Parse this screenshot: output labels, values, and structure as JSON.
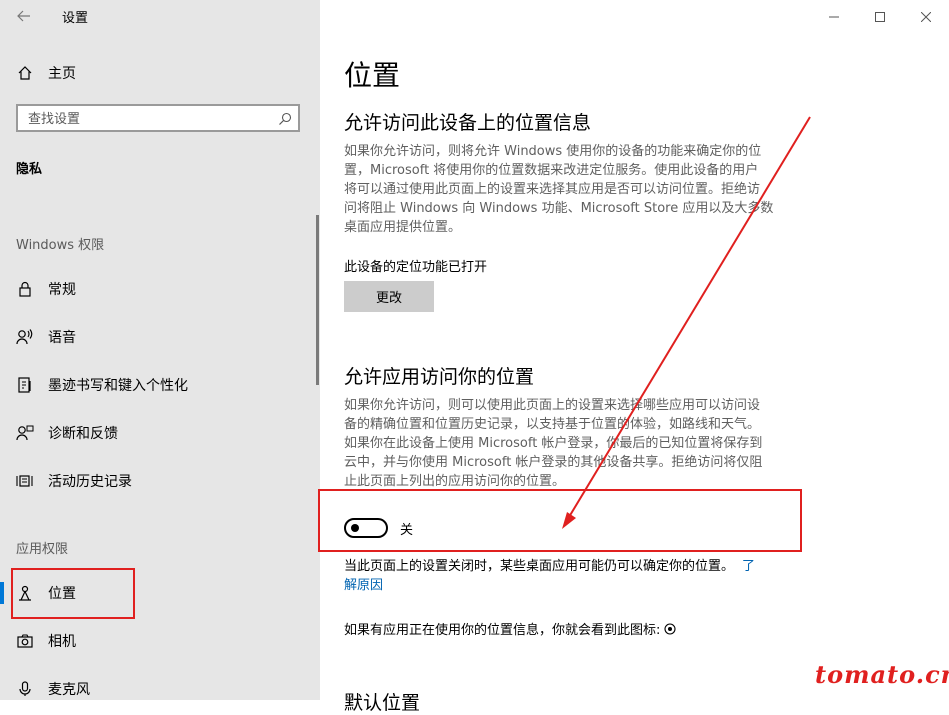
{
  "window": {
    "title": "设置"
  },
  "sidebar": {
    "home_label": "主页",
    "search_placeholder": "查找设置",
    "privacy_label": "隐私",
    "windows_section": "Windows 权限",
    "windows_items": [
      {
        "label": "常规",
        "icon": "lock-icon"
      },
      {
        "label": "语音",
        "icon": "speech-icon"
      },
      {
        "label": "墨迹书写和键入个性化",
        "icon": "pen-icon"
      },
      {
        "label": "诊断和反馈",
        "icon": "feedback-icon"
      },
      {
        "label": "活动历史记录",
        "icon": "history-icon"
      }
    ],
    "app_section": "应用权限",
    "app_items": [
      {
        "label": "位置",
        "icon": "location-icon",
        "active": true
      },
      {
        "label": "相机",
        "icon": "camera-icon"
      },
      {
        "label": "麦克风",
        "icon": "microphone-icon"
      }
    ]
  },
  "main": {
    "page_title": "位置",
    "section1": {
      "heading": "允许访问此设备上的位置信息",
      "description_lines": [
        "如果你允许访问，则将允许 Windows 使用你的设备的功能来确定你的位",
        "置，Microsoft 将使用你的位置数据来改进定位服务。使用此设备的用户",
        "将可以通过使用此页面上的设置来选择其应用是否可以访问位置。拒绝访",
        "问将阻止 Windows 向 Windows 功能、Microsoft Store 应用以及大多数",
        "桌面应用提供位置。"
      ],
      "status": "此设备的定位功能已打开",
      "change_button": "更改"
    },
    "section2": {
      "heading": "允许应用访问你的位置",
      "description_lines": [
        "如果你允许访问，则可以使用此页面上的设置来选择哪些应用可以访问设",
        "备的精确位置和位置历史记录，以支持基于位置的体验，如路线和天气。",
        "如果你在此设备上使用 Microsoft 帐户登录，你最后的已知位置将保存到",
        "云中，并与你使用 Microsoft 帐户登录的其他设备共享。拒绝访问将仅阻",
        "止此页面上列出的应用访问你的位置。"
      ],
      "toggle_state": "关",
      "note_line1": "当此页面上的设置关闭时，某些桌面应用可能仍可以确定你的位置。",
      "note_link_part1": "了",
      "note_link_part2": "解原因",
      "icon_note": "如果有应用正在使用你的位置信息，你就会看到此图标:"
    },
    "section3_heading": "默认位置"
  },
  "watermark": "tomato.cm",
  "colors": {
    "sidebar_bg": "#e6e6e6",
    "accent": "#0078d7",
    "link": "#0063b1",
    "annotation_red": "#e0201f"
  }
}
